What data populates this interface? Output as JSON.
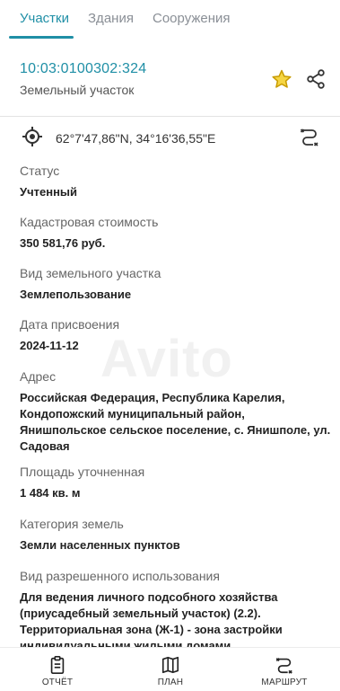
{
  "tabs": [
    {
      "label": "Участки",
      "active": true
    },
    {
      "label": "Здания",
      "active": false
    },
    {
      "label": "Сооружения",
      "active": false
    }
  ],
  "parcel": {
    "id": "10:03:0100302:324",
    "type": "Земельный участок"
  },
  "location": {
    "coordinates": "62°7'47,86\"N, 34°16'36,55\"E"
  },
  "fields": {
    "status": {
      "label": "Статус",
      "value": "Учтенный"
    },
    "cost": {
      "label": "Кадастровая стоимость",
      "value": "350 581,76 руб."
    },
    "kind": {
      "label": "Вид земельного участка",
      "value": "Землепользование"
    },
    "date": {
      "label": "Дата присвоения",
      "value": "2024-11-12"
    },
    "address": {
      "label": "Адрес",
      "value": "Российская Федерация, Республика Карелия, Кондопожский муниципальный район, Янишпольское сельское поселение, с. Янишполе, ул. Садовая"
    },
    "area": {
      "label": "Площадь уточненная",
      "value": "1 484 кв. м"
    },
    "category": {
      "label": "Категория земель",
      "value": "Земли населенных пунктов"
    },
    "usage": {
      "label": "Вид разрешенного использования",
      "value": "Для ведения личного подсобного хозяйства (приусадебный земельный участок) (2.2). Территориальная зона (Ж-1) -  зона застройки индивидуальными жилыми домами"
    }
  },
  "watermark": "Avito",
  "bottom_nav": {
    "report": "ОТЧЁТ",
    "plan": "ПЛАН",
    "route": "МАРШРУТ"
  },
  "colors": {
    "accent": "#1f8fa6",
    "star": "#e6b800"
  },
  "icons": [
    "star-icon",
    "share-icon",
    "locate-icon",
    "route-icon",
    "report-icon",
    "map-icon"
  ]
}
